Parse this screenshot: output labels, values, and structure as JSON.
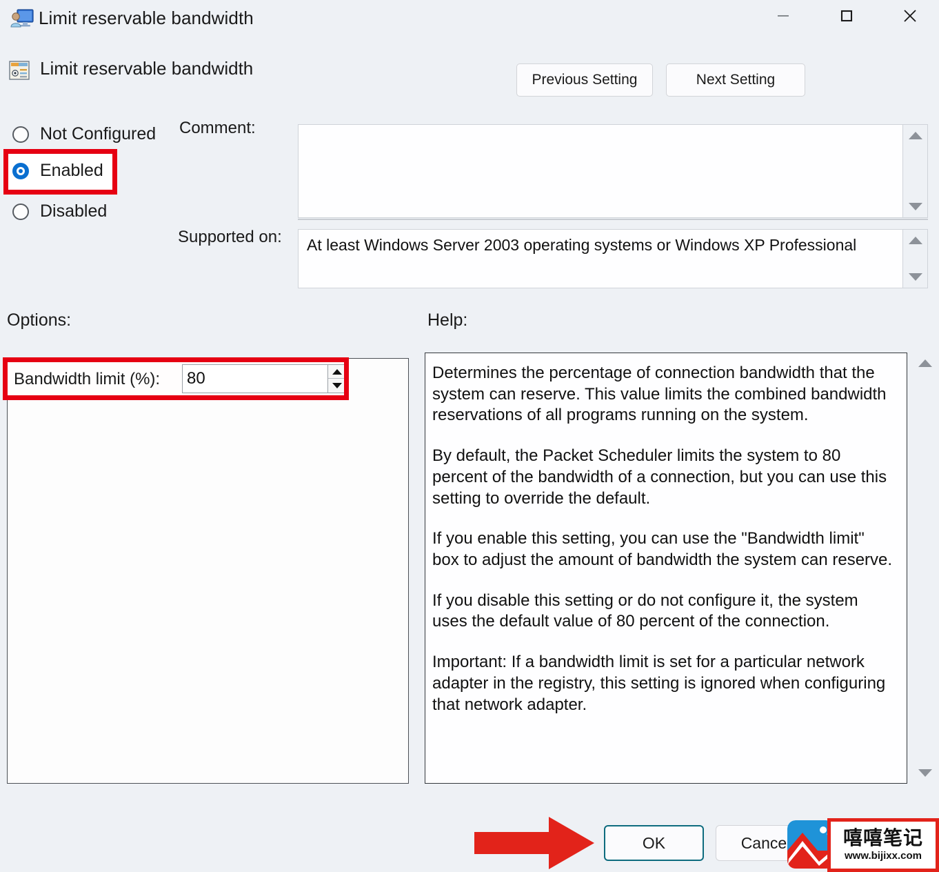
{
  "window": {
    "title": "Limit reservable bandwidth",
    "icon": "computer-user-icon",
    "controls": {
      "minimize": "—",
      "maximize": "□",
      "close": "✕"
    }
  },
  "header": {
    "icon": "policy-setting-icon",
    "title": "Limit reservable bandwidth",
    "previous_button": "Previous Setting",
    "next_button": "Next Setting"
  },
  "state": {
    "options": [
      {
        "label": "Not Configured",
        "selected": false
      },
      {
        "label": "Enabled",
        "selected": true
      },
      {
        "label": "Disabled",
        "selected": false
      }
    ],
    "selected_value": "Enabled"
  },
  "comment": {
    "label": "Comment:",
    "value": "",
    "placeholder": ""
  },
  "supported_on": {
    "label": "Supported on:",
    "value": "At least Windows Server 2003 operating systems or Windows XP Professional"
  },
  "options_panel": {
    "label": "Options:",
    "bandwidth": {
      "label": "Bandwidth limit (%):",
      "value": "80",
      "spinner_up": "spin-up-icon",
      "spinner_down": "spin-down-icon"
    }
  },
  "help_panel": {
    "label": "Help:",
    "paragraphs": [
      "Determines the percentage of connection bandwidth that the system can reserve. This value limits the combined bandwidth reservations of all programs running on the system.",
      "By default, the Packet Scheduler limits the system to 80 percent of the bandwidth of a connection, but you can use this setting to override the default.",
      "If you enable this setting, you can use the \"Bandwidth limit\" box to adjust the amount of bandwidth the system can reserve.",
      "If you disable this setting or do not configure it, the system uses the default value of 80 percent of the connection.",
      "Important: If a bandwidth limit is set for a particular network adapter in the registry, this setting is ignored when configuring that network adapter."
    ]
  },
  "footer": {
    "ok_label": "OK",
    "cancel_label": "Cancel"
  },
  "annotations": {
    "highlight_color": "#e60012",
    "arrow_color": "#e2231a",
    "arrow_target": "ok-button",
    "highlighted_regions": [
      "Enabled",
      "Bandwidth limit (%)"
    ]
  },
  "watermark": {
    "brand_cn": "嘻嘻笔记",
    "url": "www.bijixx.com",
    "logo": "mountain-logo-icon"
  },
  "colors": {
    "window_bg": "#eef1f5",
    "accent_blue": "#0a6fd0",
    "ok_border": "#0d6b7e",
    "red": "#e60012"
  }
}
